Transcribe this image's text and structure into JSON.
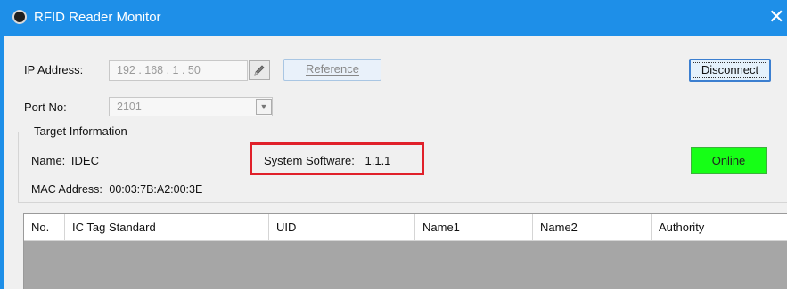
{
  "window": {
    "title": "RFID Reader Monitor",
    "close_symbol": "✕",
    "accent_color": "#1e8fe8"
  },
  "connection": {
    "ip_label": "IP Address:",
    "ip_value": "192 . 168 . 1 . 50",
    "port_label": "Port No:",
    "port_value": "2101",
    "reference_label": "Reference",
    "disconnect_label": "Disconnect"
  },
  "target_info": {
    "group_label": "Target Information",
    "name_label": "Name:",
    "name_value": "IDEC",
    "system_software_label": "System Software:",
    "system_software_value": "1.1.1",
    "mac_label": "MAC Address:",
    "mac_value": "00:03:7B:A2:00:3E",
    "status": "Online",
    "status_color": "#16ff16",
    "highlight_color": "#e0202a"
  },
  "table": {
    "columns": [
      "No.",
      "IC Tag Standard",
      "UID",
      "Name1",
      "Name2",
      "Authority"
    ],
    "rows": []
  }
}
